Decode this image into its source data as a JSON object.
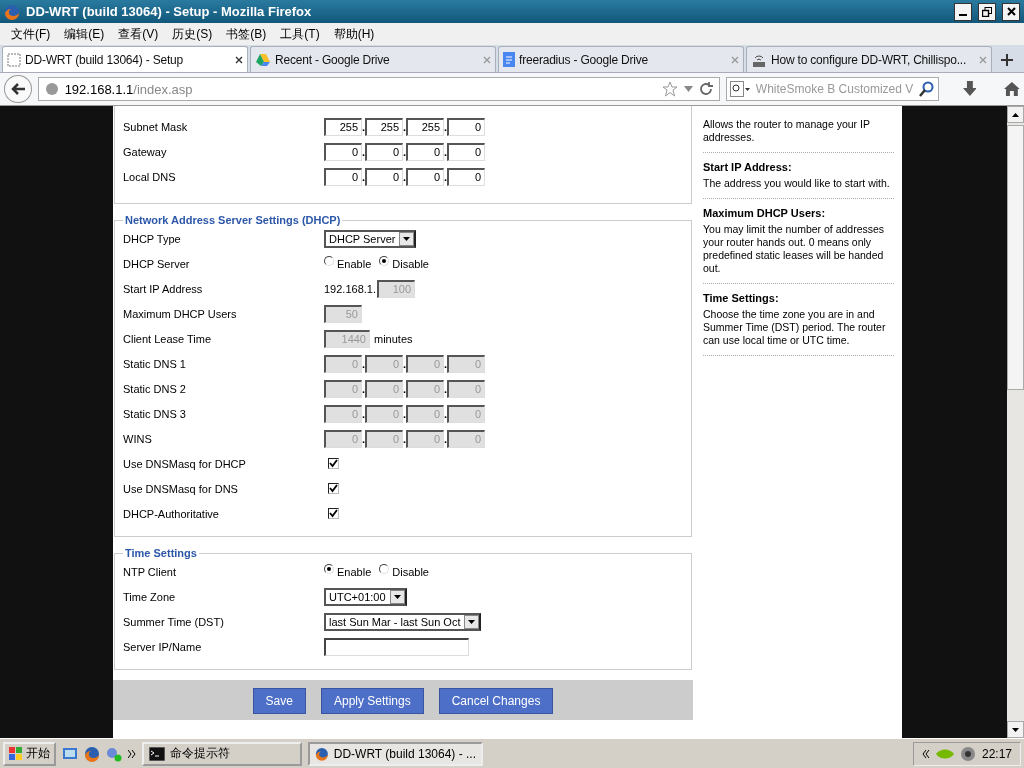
{
  "window": {
    "title": "DD-WRT (build 13064) - Setup - Mozilla Firefox"
  },
  "menu": [
    "文件(F)",
    "编辑(E)",
    "查看(V)",
    "历史(S)",
    "书签(B)",
    "工具(T)",
    "帮助(H)"
  ],
  "tabs": [
    {
      "label": "DD-WRT (build 13064) - Setup",
      "selected": true,
      "kind": "blank"
    },
    {
      "label": "Recent - Google Drive",
      "selected": false,
      "kind": "drive"
    },
    {
      "label": "freeradius - Google Drive",
      "selected": false,
      "kind": "doc"
    },
    {
      "label": "How to configure DD-WRT, Chillispo...",
      "selected": false,
      "kind": "site"
    }
  ],
  "address": {
    "host": "192.168.1.1",
    "path": "/index.asp"
  },
  "search": {
    "placeholder": "WhiteSmoke B Customized V"
  },
  "sections": [
    {
      "rows": [
        {
          "kind": "ip",
          "label": "Subnet Mask",
          "octets": [
            "255",
            "255",
            "255",
            "0"
          ],
          "separators": [
            ".",
            ".",
            "."
          ],
          "disabled": false
        },
        {
          "kind": "ip",
          "label": "Gateway",
          "octets": [
            "0",
            "0",
            "0",
            "0"
          ],
          "separators": [
            ".",
            ".",
            "."
          ],
          "disabled": false
        },
        {
          "kind": "ip",
          "label": "Local DNS",
          "octets": [
            "0",
            "0",
            "0",
            "0"
          ],
          "separators": [
            ".",
            ".",
            "."
          ],
          "disabled": false
        }
      ]
    },
    {
      "legend": "Network Address Server Settings (DHCP)",
      "rows": [
        {
          "kind": "select",
          "label": "DHCP Type",
          "value": "DHCP Server"
        },
        {
          "kind": "radio",
          "label": "DHCP Server",
          "options": [
            {
              "label": "Enable",
              "selected": false
            },
            {
              "label": "Disable",
              "selected": true
            }
          ]
        },
        {
          "kind": "prefixed",
          "label": "Start IP Address",
          "prefix": "192.168.1.",
          "value": "100",
          "disabled": true
        },
        {
          "kind": "number",
          "label": "Maximum DHCP Users",
          "value": "50",
          "disabled": true
        },
        {
          "kind": "number",
          "label": "Client Lease Time",
          "value": "1440",
          "unit": "minutes",
          "disabled": true
        },
        {
          "kind": "ip",
          "label": "Static DNS 1",
          "octets": [
            "0",
            "0",
            "0",
            "0"
          ],
          "separators": [
            ".",
            ".",
            "."
          ],
          "disabled": true
        },
        {
          "kind": "ip",
          "label": "Static DNS 2",
          "octets": [
            "0",
            "0",
            "0",
            "0"
          ],
          "separators": [
            ".",
            ".",
            "."
          ],
          "disabled": true
        },
        {
          "kind": "ip",
          "label": "Static DNS 3",
          "octets": [
            "0",
            "0",
            "0",
            "0"
          ],
          "separators": [
            ".",
            ".",
            "."
          ],
          "disabled": true
        },
        {
          "kind": "ip",
          "label": "WINS",
          "octets": [
            "0",
            "0",
            "0",
            "0"
          ],
          "separators": [
            ".",
            ".",
            "."
          ],
          "disabled": true
        },
        {
          "kind": "checkbox",
          "label": "Use DNSMasq for DHCP",
          "checked": true
        },
        {
          "kind": "checkbox",
          "label": "Use DNSMasq for DNS",
          "checked": true
        },
        {
          "kind": "checkbox",
          "label": "DHCP-Authoritative",
          "checked": true
        }
      ]
    },
    {
      "legend": "Time Settings",
      "rows": [
        {
          "kind": "radio",
          "label": "NTP Client",
          "options": [
            {
              "label": "Enable",
              "selected": true
            },
            {
              "label": "Disable",
              "selected": false
            }
          ]
        },
        {
          "kind": "select",
          "label": "Time Zone",
          "value": "UTC+01:00"
        },
        {
          "kind": "select",
          "label": "Summer Time (DST)",
          "value": "last Sun Mar - last Sun Oct"
        },
        {
          "kind": "text",
          "label": "Server IP/Name"
        }
      ]
    }
  ],
  "buttons": [
    "Save",
    "Apply Settings",
    "Cancel Changes"
  ],
  "help": [
    {
      "text": "Allows the router to manage your IP addresses."
    },
    {
      "title": "Start IP Address:",
      "text": "The address you would like to start with."
    },
    {
      "title": "Maximum DHCP Users:",
      "text": "You may limit the number of addresses your router hands out. 0 means only predefined static leases will be handed out."
    },
    {
      "title": "Time Settings:",
      "text": "Choose the time zone you are in and Summer Time (DST) period. The router can use local time or UTC time."
    }
  ],
  "taskbar": {
    "start": "开始",
    "tasks": [
      {
        "label": "命令提示符",
        "selected": false,
        "kind": "cmd"
      },
      {
        "label": "DD-WRT (build 13064) - ...",
        "selected": true,
        "kind": "firefox"
      }
    ],
    "clock": "22:17"
  }
}
